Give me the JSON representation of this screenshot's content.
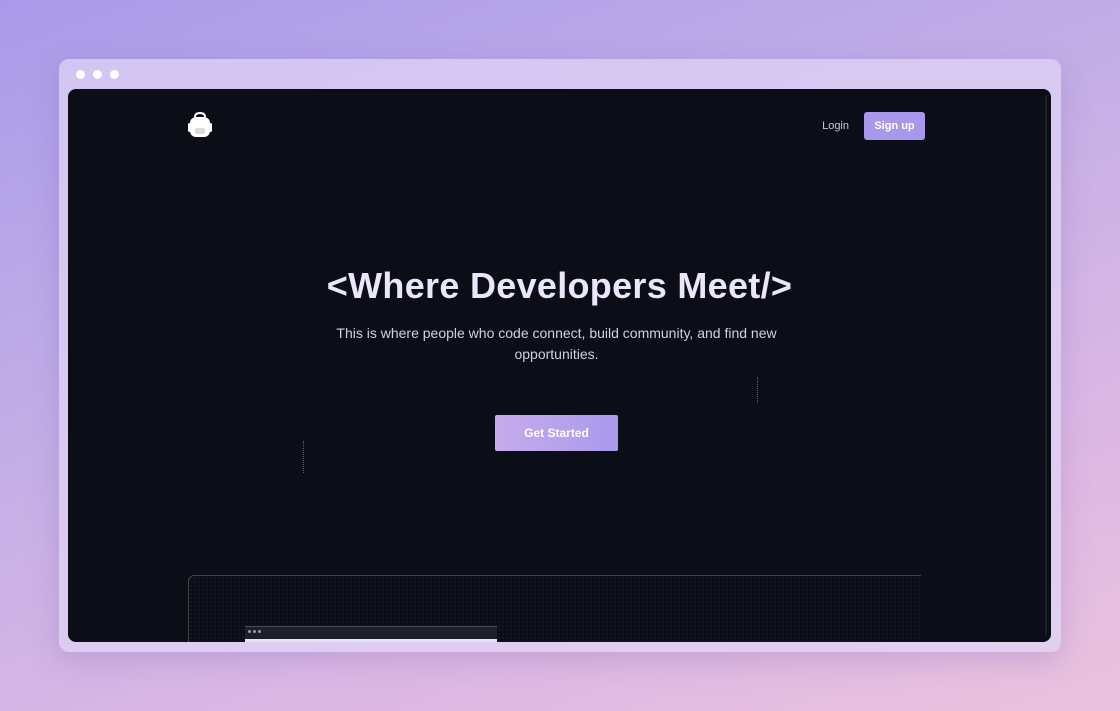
{
  "nav": {
    "login_label": "Login",
    "signup_label": "Sign up"
  },
  "hero": {
    "headline": "<Where Developers Meet/>",
    "subtitle": "This is where people who code connect, build community, and find new opportunities.",
    "cta_label": "Get Started"
  },
  "icons": {
    "logo": "backpack-logo-icon"
  },
  "colors": {
    "page_background": "#0b0d17",
    "accent": "#a897ea",
    "headline": "#ece6fb"
  }
}
